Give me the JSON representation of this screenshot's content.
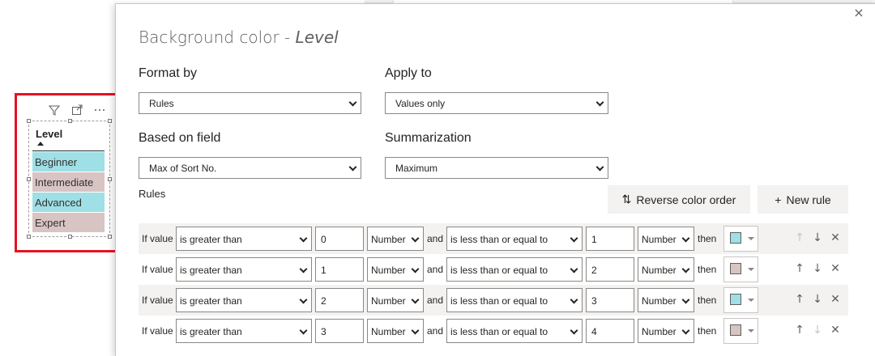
{
  "visual": {
    "title": "Level",
    "rows": [
      {
        "label": "Beginner",
        "color": "#9fdfe6"
      },
      {
        "label": "Intermediate",
        "color": "#d8c4c3"
      },
      {
        "label": "Advanced",
        "color": "#9fdfe6"
      },
      {
        "label": "Expert",
        "color": "#d8c4c3"
      }
    ],
    "header_icons": [
      "filter-icon",
      "focus-mode-icon",
      "more-options-icon"
    ]
  },
  "dialog": {
    "title_prefix": "Background color - ",
    "title_field": "Level",
    "format_by": {
      "label": "Format by",
      "value": "Rules"
    },
    "apply_to": {
      "label": "Apply to",
      "value": "Values only"
    },
    "based_on": {
      "label": "Based on field",
      "value": "Max of Sort No."
    },
    "summarization": {
      "label": "Summarization",
      "value": "Maximum"
    },
    "rules_label": "Rules",
    "reverse_btn": "Reverse color order",
    "new_rule_btn": "New rule",
    "rules": [
      {
        "if": "If value",
        "op1": "is greater than",
        "v1": "0",
        "t1": "Number",
        "and": "and",
        "op2": "is less than or equal to",
        "v2": "1",
        "t2": "Number",
        "then": "then",
        "color": "#9fdfe6",
        "up_enabled": false,
        "down_enabled": true
      },
      {
        "if": "If value",
        "op1": "is greater than",
        "v1": "1",
        "t1": "Number",
        "and": "and",
        "op2": "is less than or equal to",
        "v2": "2",
        "t2": "Number",
        "then": "then",
        "color": "#d8c4c3",
        "up_enabled": true,
        "down_enabled": true
      },
      {
        "if": "If value",
        "op1": "is greater than",
        "v1": "2",
        "t1": "Number",
        "and": "and",
        "op2": "is less than or equal to",
        "v2": "3",
        "t2": "Number",
        "then": "then",
        "color": "#9fdfe6",
        "up_enabled": true,
        "down_enabled": true
      },
      {
        "if": "If value",
        "op1": "is greater than",
        "v1": "3",
        "t1": "Number",
        "and": "and",
        "op2": "is less than or equal to",
        "v2": "4",
        "t2": "Number",
        "then": "then",
        "color": "#d8c4c3",
        "up_enabled": true,
        "down_enabled": false
      }
    ]
  },
  "colors": {
    "highlight_frame": "#e81123",
    "row_shade": "#f3f2f1"
  }
}
